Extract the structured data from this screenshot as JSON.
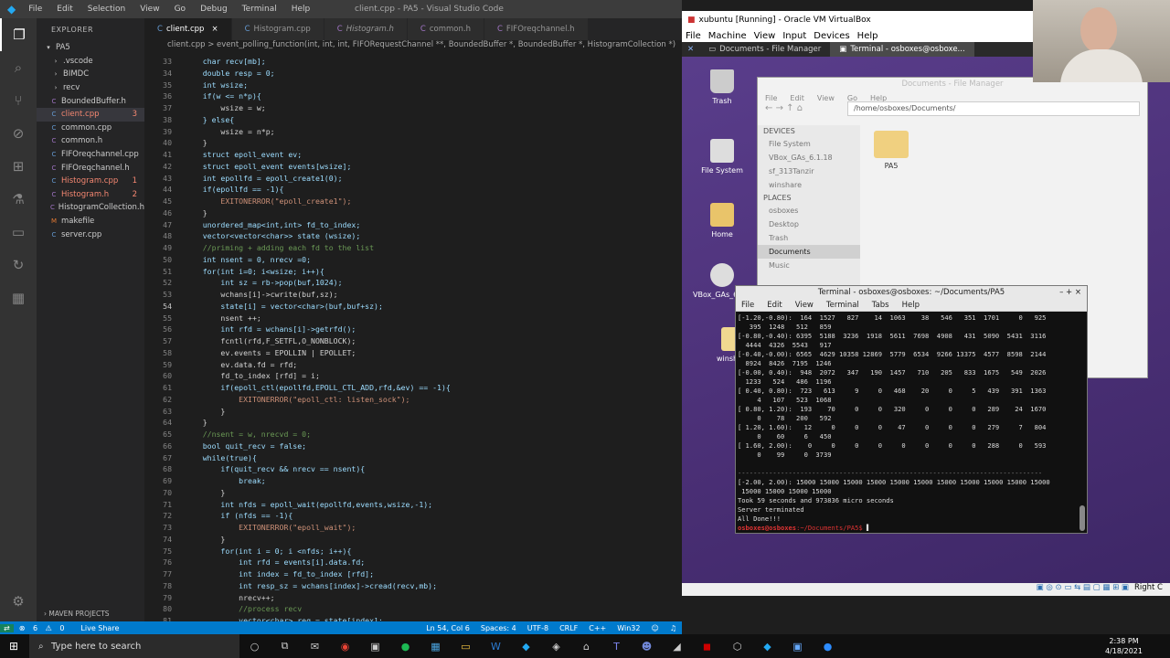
{
  "vscode": {
    "title": "client.cpp - PA5 - Visual Studio Code",
    "menu": [
      "File",
      "Edit",
      "Selection",
      "View",
      "Go",
      "Debug",
      "Terminal",
      "Help"
    ],
    "explorer_header": "EXPLORER",
    "project": "PA5",
    "files": [
      {
        "name": ".vscode",
        "type": "folder",
        "color": "#ccc"
      },
      {
        "name": "BIMDC",
        "type": "folder",
        "color": "#ccc"
      },
      {
        "name": "recv",
        "type": "folder",
        "color": "#ccc"
      },
      {
        "name": "BoundedBuffer.h",
        "type": "h",
        "color": "#ccc"
      },
      {
        "name": "client.cpp",
        "type": "cpp",
        "color": "#f48771",
        "badge": "3",
        "selected": true
      },
      {
        "name": "common.cpp",
        "type": "cpp",
        "color": "#ccc"
      },
      {
        "name": "common.h",
        "type": "h",
        "color": "#ccc"
      },
      {
        "name": "FIFOreqchannel.cpp",
        "type": "cpp",
        "color": "#ccc"
      },
      {
        "name": "FIFOreqchannel.h",
        "type": "h",
        "color": "#ccc"
      },
      {
        "name": "Histogram.cpp",
        "type": "cpp",
        "color": "#f48771",
        "badge": "1"
      },
      {
        "name": "Histogram.h",
        "type": "h",
        "color": "#f48771",
        "badge": "2"
      },
      {
        "name": "HistogramCollection.h",
        "type": "h",
        "color": "#ccc"
      },
      {
        "name": "makefile",
        "type": "mk",
        "color": "#ccc"
      },
      {
        "name": "server.cpp",
        "type": "cpp",
        "color": "#ccc"
      }
    ],
    "maven": "MAVEN PROJECTS",
    "tabs": [
      "client.cpp",
      "Histogram.cpp",
      "Histogram.h",
      "common.h",
      "FIFOreqchannel.h"
    ],
    "breadcrumb": "client.cpp > event_polling_function(int, int, int, FIFORequestChannel **, BoundedBuffer *, BoundedBuffer *, HistogramCollection *)",
    "code_lines": [
      {
        "n": "33",
        "t": "    char recv[mb];"
      },
      {
        "n": "34",
        "t": "    double resp = 0;"
      },
      {
        "n": "35",
        "t": "    int wsize;"
      },
      {
        "n": "36",
        "t": "    if(w <= n*p){"
      },
      {
        "n": "37",
        "t": "        wsize = w;"
      },
      {
        "n": "38",
        "t": "    } else{"
      },
      {
        "n": "39",
        "t": "        wsize = n*p;"
      },
      {
        "n": "40",
        "t": "    }"
      },
      {
        "n": "41",
        "t": "    struct epoll_event ev;"
      },
      {
        "n": "42",
        "t": "    struct epoll_event events[wsize];"
      },
      {
        "n": "43",
        "t": "    int epollfd = epoll_create1(0);"
      },
      {
        "n": "44",
        "t": "    if(epollfd == -1){"
      },
      {
        "n": "45",
        "t": "        EXITONERROR(\"epoll_create1\");"
      },
      {
        "n": "46",
        "t": "    }"
      },
      {
        "n": "47",
        "t": "    unordered_map<int,int> fd_to_index;"
      },
      {
        "n": "48",
        "t": "    vector<vector<char>> state (wsize);"
      },
      {
        "n": "49",
        "t": "    //priming + adding each fd to the list"
      },
      {
        "n": "50",
        "t": "    int nsent = 0, nrecv =0;"
      },
      {
        "n": "51",
        "t": "    for(int i=0; i<wsize; i++){"
      },
      {
        "n": "52",
        "t": "        int sz = rb->pop(buf,1024);"
      },
      {
        "n": "53",
        "t": "        wchans[i]->cwrite(buf,sz);"
      },
      {
        "n": "54",
        "t": "        state[i] = vector<char>(buf,buf+sz);"
      },
      {
        "n": "55",
        "t": "        nsent ++;"
      },
      {
        "n": "56",
        "t": "        int rfd = wchans[i]->getrfd();"
      },
      {
        "n": "57",
        "t": "        fcntl(rfd,F_SETFL,O_NONBLOCK);"
      },
      {
        "n": "58",
        "t": "        ev.events = EPOLLIN | EPOLLET;"
      },
      {
        "n": "59",
        "t": "        ev.data.fd = rfd;"
      },
      {
        "n": "60",
        "t": "        fd_to_index [rfd] = i;"
      },
      {
        "n": "61",
        "t": "        if(epoll_ctl(epollfd,EPOLL_CTL_ADD,rfd,&ev) == -1){"
      },
      {
        "n": "62",
        "t": "            EXITONERROR(\"epoll_ctl: listen_sock\");"
      },
      {
        "n": "63",
        "t": "        }"
      },
      {
        "n": "64",
        "t": "    }"
      },
      {
        "n": "65",
        "t": "    //nsent = w, nrecvd = 0;"
      },
      {
        "n": "66",
        "t": "    bool quit_recv = false;"
      },
      {
        "n": "67",
        "t": "    while(true){"
      },
      {
        "n": "68",
        "t": "        if(quit_recv && nrecv == nsent){"
      },
      {
        "n": "69",
        "t": "            break;"
      },
      {
        "n": "70",
        "t": "        }"
      },
      {
        "n": "71",
        "t": "        int nfds = epoll_wait(epollfd,events,wsize,-1);"
      },
      {
        "n": "72",
        "t": "        if (nfds == -1){"
      },
      {
        "n": "73",
        "t": "            EXITONERROR(\"epoll_wait\");"
      },
      {
        "n": "74",
        "t": "        }"
      },
      {
        "n": "75",
        "t": "        for(int i = 0; i <nfds; i++){"
      },
      {
        "n": "76",
        "t": "            int rfd = events[i].data.fd;"
      },
      {
        "n": "77",
        "t": "            int index = fd_to_index [rfd];"
      },
      {
        "n": "78",
        "t": "            int resp_sz = wchans[index]->cread(recv,mb);"
      },
      {
        "n": "79",
        "t": "            nrecv++;"
      },
      {
        "n": "80",
        "t": "            //process recv"
      },
      {
        "n": "81",
        "t": "            vector<char> req = state[index];"
      }
    ],
    "status": {
      "branch": "Live Share",
      "errors": "6",
      "warnings": "0",
      "pos": "Ln 54, Col 6",
      "spaces": "Spaces: 4",
      "enc": "UTF-8",
      "eol": "CRLF",
      "lang": "C++",
      "os": "Win32"
    }
  },
  "vm": {
    "title": "xubuntu [Running] - Oracle VM VirtualBox",
    "menu": [
      "File",
      "Machine",
      "View",
      "Input",
      "Devices",
      "Help"
    ],
    "panel_tasks": [
      "Documents - File Manager",
      "Terminal - osboxes@osboxe..."
    ],
    "desktop_icons": [
      "Trash",
      "File System",
      "Home",
      "VBox_GAs_6.1.18",
      "winshare"
    ],
    "host_key": "Right C",
    "file_manager": {
      "title": "Documents - File Manager",
      "menu": [
        "File",
        "Edit",
        "View",
        "Go",
        "Help"
      ],
      "path": "/home/osboxes/Documents/",
      "devices_header": "DEVICES",
      "devices": [
        "File System",
        "VBox_GAs_6.1.18",
        "sf_313Tanzir",
        "winshare"
      ],
      "places_header": "PLACES",
      "places": [
        "osboxes",
        "Desktop",
        "Trash",
        "Documents",
        "Music"
      ],
      "folder": "PA5"
    },
    "terminal": {
      "title": "Terminal - osboxes@osboxes: ~/Documents/PA5",
      "menu": [
        "File",
        "Edit",
        "View",
        "Terminal",
        "Tabs",
        "Help"
      ],
      "lines": [
        "[-1.20,-0.80):  164  1527   827    14  1063    38   546   351  1701     0   925",
        "   395  1248   512   859",
        "[-0.80,-0.40): 6395  5188  3236  1918  5611  7698  4908   431  5090  5431  3116",
        "  4444  4326  5543   917",
        "[-0.40,-0.00): 6565  4629 10358 12869  5779  6534  9266 13375  4577  8598  2144",
        "  8924  8426  7195  1246",
        "[-0.00, 0.40):  948  2072   347   190  1457   710   205   833  1675   549  2026",
        "  1233   524   486  1196",
        "[ 0.40, 0.80):  723   613     9     0   468    20     0     5   439   391  1363",
        "     4   107   523  1068",
        "[ 0.80, 1.20):  193    70     0     0   320     0     0     0   289    24  1670",
        "     0    78   200   592",
        "[ 1.20, 1.60):   12     0     0     0    47     0     0     0   279     7   804",
        "     0    60     6   450",
        "[ 1.60, 2.00):    0     0     0     0     0     0     0     0   288     0   593",
        "     0    99     0  3739",
        "",
        "------------------------------------------------------------------------------",
        "[-2.00, 2.00): 15000 15000 15000 15000 15000 15000 15000 15000 15000 15000 15000",
        " 15000 15000 15000 15000",
        "Took 59 seconds and 973836 micro seconds",
        "Server terminated",
        "All Done!!!"
      ],
      "prompt_user": "osboxes@osboxes",
      "prompt_path": ":~/Documents/PA5$ "
    }
  },
  "taskbar": {
    "search_placeholder": "Type here to search",
    "time": "2:38 PM",
    "date": "4/18/2021"
  }
}
